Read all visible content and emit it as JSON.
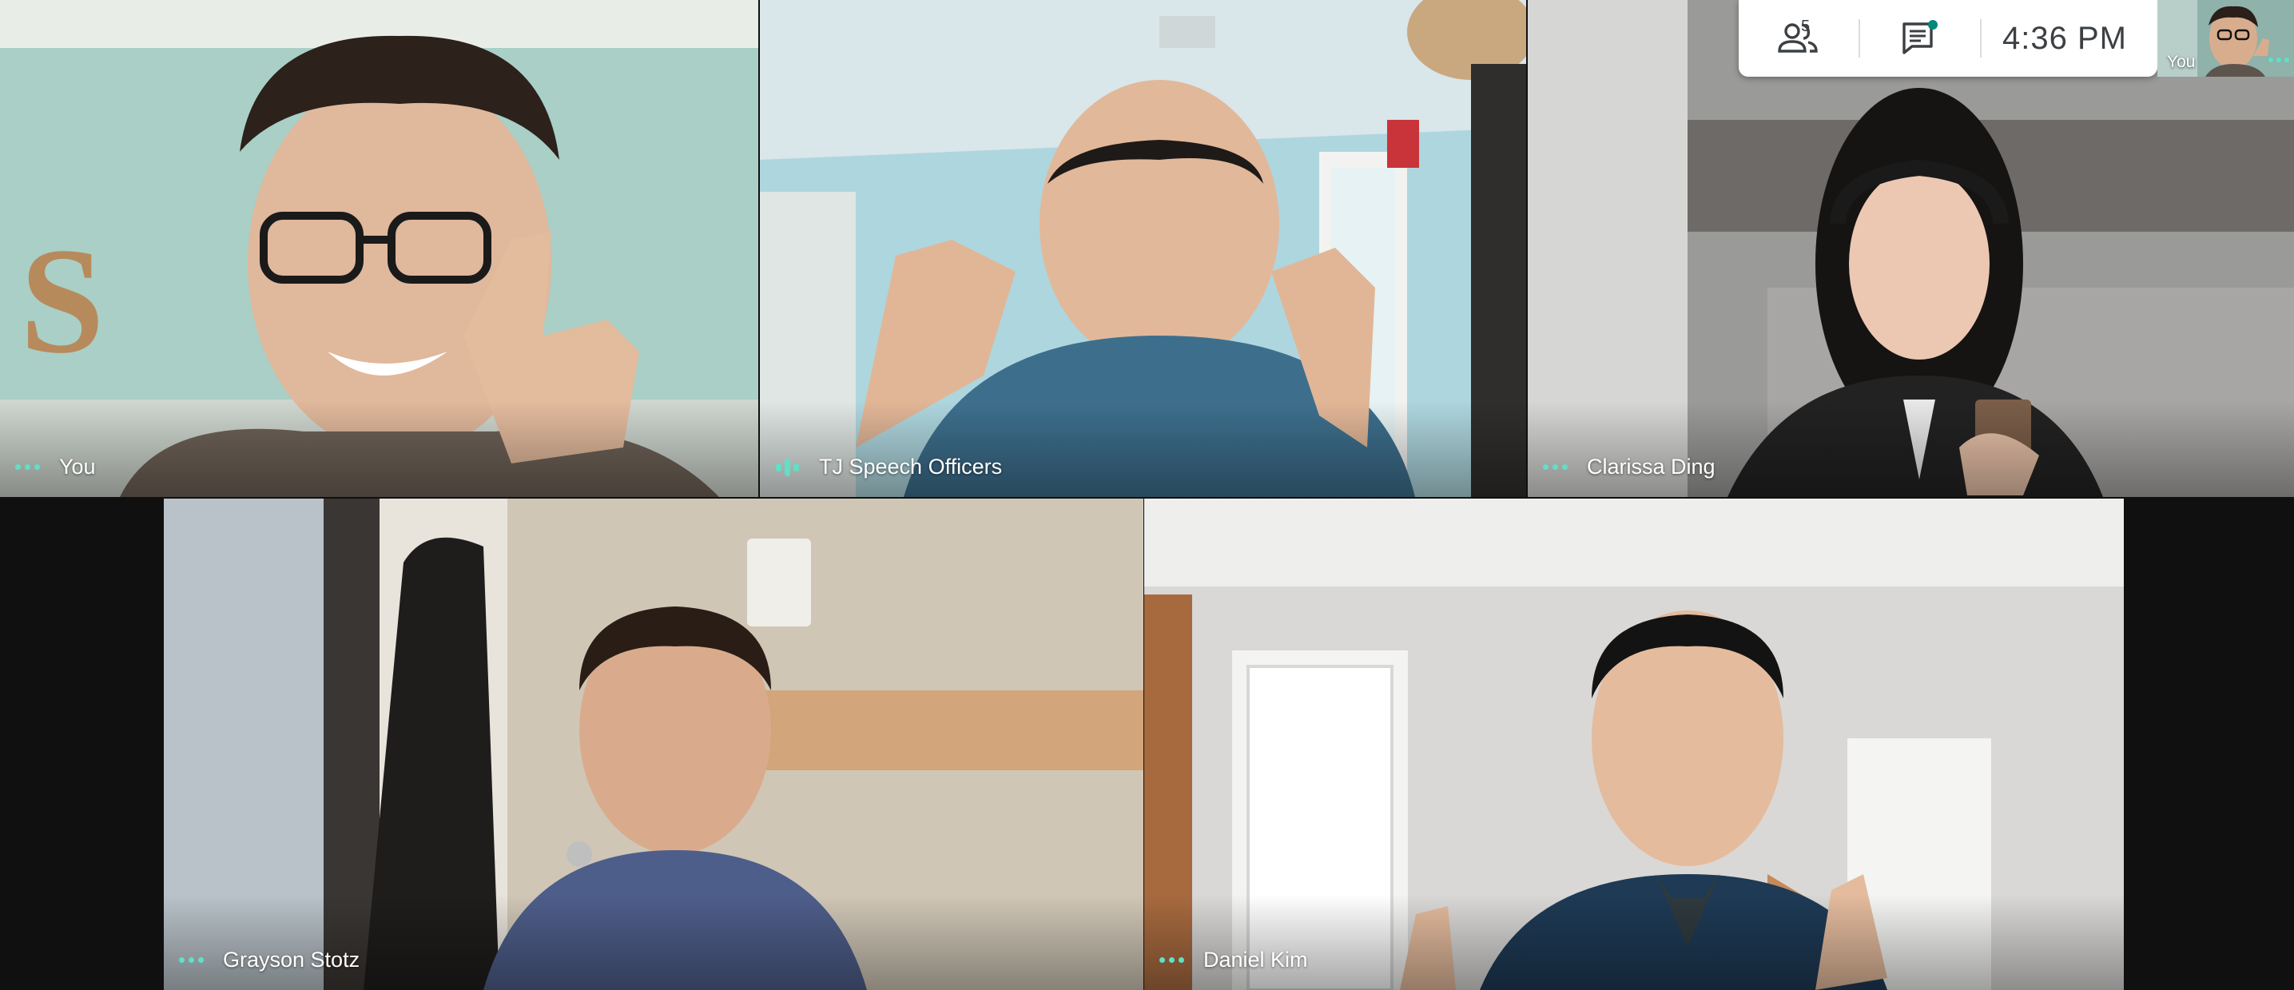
{
  "controls": {
    "people_count": "5",
    "clock": "4:36 PM",
    "self_view_label": "You",
    "chat_badge_color": "#00897b"
  },
  "tiles": [
    {
      "name": "You",
      "indicator": "dots"
    },
    {
      "name": "TJ Speech Officers",
      "indicator": "bars"
    },
    {
      "name": "Clarissa Ding",
      "indicator": "dots"
    },
    {
      "name": "Grayson Stotz",
      "indicator": "dots"
    },
    {
      "name": "Daniel Kim",
      "indicator": "dots"
    }
  ],
  "colors": {
    "accent": "#5fe0c8",
    "background": "#111111",
    "bar": "#ffffff"
  }
}
